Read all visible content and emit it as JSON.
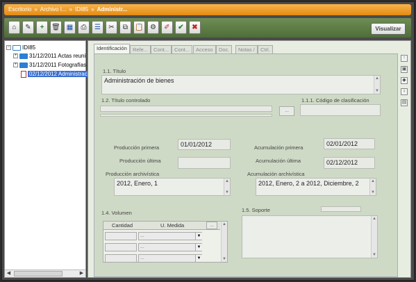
{
  "breadcrumb": {
    "items": [
      "Escritorio",
      "Archivo I...",
      "IDI85"
    ],
    "current": "Administr...",
    "separator": "»"
  },
  "toolbar": {
    "buttons": [
      {
        "name": "home-icon",
        "glyph": "⌂"
      },
      {
        "name": "edit-icon",
        "glyph": "✎"
      },
      {
        "name": "add-icon",
        "glyph": "+"
      },
      {
        "name": "delete-icon",
        "glyph": "🗑"
      },
      {
        "name": "grid-icon",
        "glyph": "▦"
      },
      {
        "name": "print-icon",
        "glyph": "⎙"
      },
      {
        "name": "list-icon",
        "glyph": "☰"
      },
      {
        "name": "tools-icon",
        "glyph": "✂"
      },
      {
        "name": "copy-icon",
        "glyph": "⧉"
      },
      {
        "name": "clipboard-icon",
        "glyph": "📋"
      },
      {
        "name": "settings-icon",
        "glyph": "⚙"
      },
      {
        "name": "pencil-icon",
        "glyph": "✐"
      },
      {
        "name": "accept-icon",
        "glyph": "✔"
      },
      {
        "name": "cancel-icon",
        "glyph": "✖"
      }
    ],
    "visualizar_label": "Visualizar"
  },
  "tree": {
    "root": "IDI85",
    "items": [
      {
        "label": "31/12/2011 Actas reuni",
        "type": "folder"
      },
      {
        "label": "31/12/2011 Fotografías",
        "type": "folder"
      },
      {
        "label": "02/12/2012 Administrac",
        "type": "doc",
        "selected": true
      }
    ]
  },
  "tabs": [
    {
      "label": "Identificación",
      "active": true
    },
    {
      "label": "Refe..."
    },
    {
      "label": "Cont..."
    },
    {
      "label": "Cont..."
    },
    {
      "label": "Acceso"
    },
    {
      "label": "Doc."
    },
    {
      "label": "Notas /"
    },
    {
      "label": "Ctrl."
    }
  ],
  "form": {
    "titulo_label": "1.1. Título",
    "titulo_value": "Administración de bienes",
    "titulo_controlado_label": "1.2. Título controlado",
    "titulo_controlado_button": "...",
    "codigo_label": "1.1.1. Código de clasificación",
    "codigo_value": "",
    "produccion_primera_label": "Producción primera",
    "produccion_primera_value": "01/01/2012",
    "produccion_ultima_label": "Producción última",
    "produccion_ultima_value": "",
    "produccion_archivistica_label": "Producción archivística",
    "produccion_archivistica_value": "2012, Enero, 1",
    "acumulacion_primera_label": "Acumulación primera",
    "acumulacion_primera_value": "02/01/2012",
    "acumulacion_ultima_label": "Acumulación última",
    "acumulacion_ultima_value": "02/12/2012",
    "acumulacion_archivistica_label": "Acumulación archivística",
    "acumulacion_archivistica_value": "2012, Enero, 2 a 2012, Diciembre, 2",
    "volumen_label": "1.4. Volumen",
    "volumen_headers": [
      "Cantidad",
      "U. Medida"
    ],
    "volumen_rows": [
      {
        "cantidad": "",
        "unidad": "..."
      },
      {
        "cantidad": "",
        "unidad": "..."
      },
      {
        "cantidad": "",
        "unidad": "..."
      }
    ],
    "volumen_button": "...",
    "soporte_label": "1.5. Soporte",
    "soporte_value": ""
  }
}
